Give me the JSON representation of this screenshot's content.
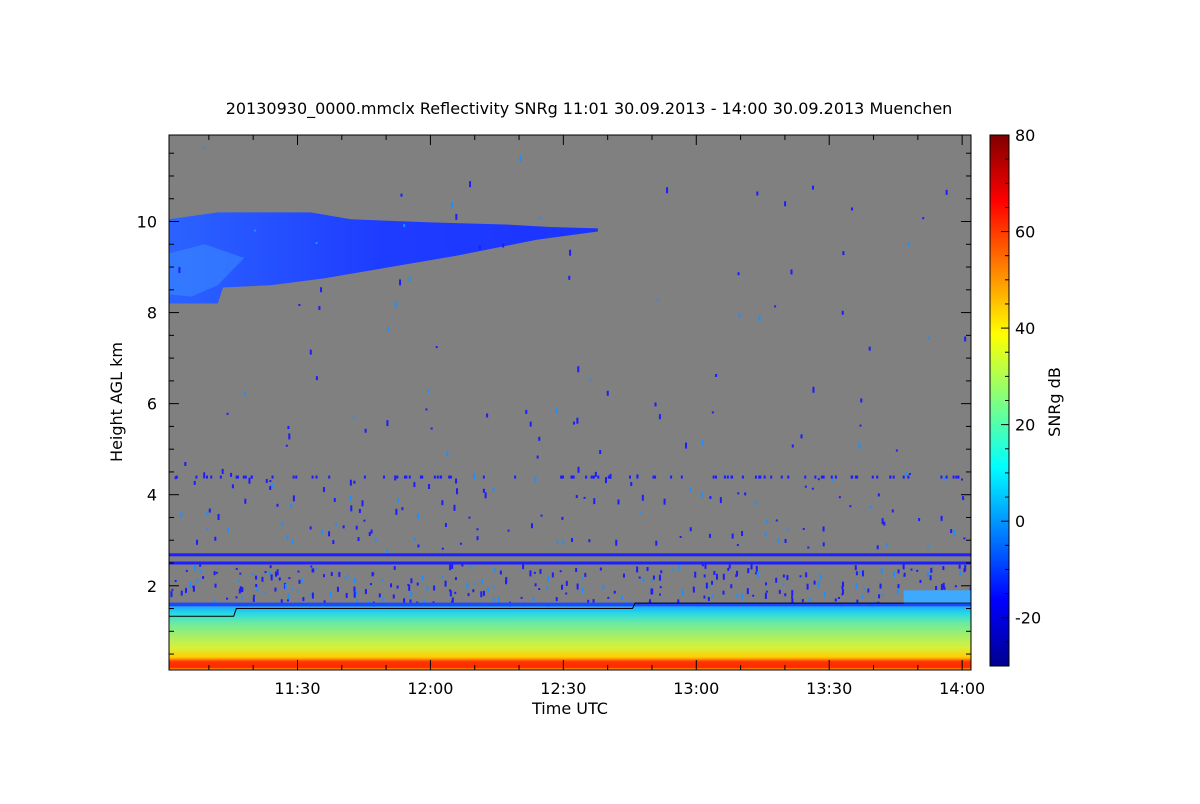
{
  "chart_data": {
    "type": "heatmap",
    "title": "20130930_0000.mmclx Reflectivity SNRg   11:01 30.09.2013 - 14:00 30.09.2013 Muenchen",
    "xlabel": "Time UTC",
    "ylabel": "Height AGL km",
    "colorbar_label": "SNRg dB",
    "x_ticks": [
      "11:30",
      "12:00",
      "12:30",
      "13:00",
      "13:30",
      "14:00"
    ],
    "x_tick_values": [
      11.5,
      12.0,
      12.5,
      13.0,
      13.5,
      14.0
    ],
    "xlim": [
      11.0167,
      14.0333
    ],
    "y_ticks": [
      "2",
      "4",
      "6",
      "8",
      "10"
    ],
    "y_tick_values": [
      2,
      4,
      6,
      8,
      10
    ],
    "ylim": [
      0.15,
      11.9
    ],
    "colorbar_ticks": [
      "-20",
      "0",
      "20",
      "40",
      "60",
      "80"
    ],
    "colorbar_tick_values": [
      -20,
      0,
      20,
      40,
      60,
      80
    ],
    "colorbar_range": [
      -30,
      80
    ],
    "colormap": [
      "#00008f",
      "#0000ff",
      "#0080ff",
      "#00ffff",
      "#80ff80",
      "#ffff00",
      "#ff8000",
      "#ff0000",
      "#800000"
    ],
    "no_data_color": "#808080",
    "features": [
      {
        "name": "upper-cloud",
        "snr_db": -15,
        "time_start": 11.0167,
        "time_end": 12.63,
        "height_top": 10.2,
        "height_bottom_start": 8.2,
        "height_bottom_end": 9.8
      },
      {
        "name": "boundary-layer",
        "snr_db": 25,
        "time_start": 11.0167,
        "time_end": 14.0333,
        "height_bottom": 0.15,
        "height_top": 1.55
      }
    ],
    "contour_line": [
      [
        11.0167,
        1.33
      ],
      [
        11.26,
        1.33
      ],
      [
        11.27,
        1.5
      ],
      [
        12.76,
        1.5
      ],
      [
        12.77,
        1.62
      ],
      [
        14.0333,
        1.62
      ]
    ]
  }
}
